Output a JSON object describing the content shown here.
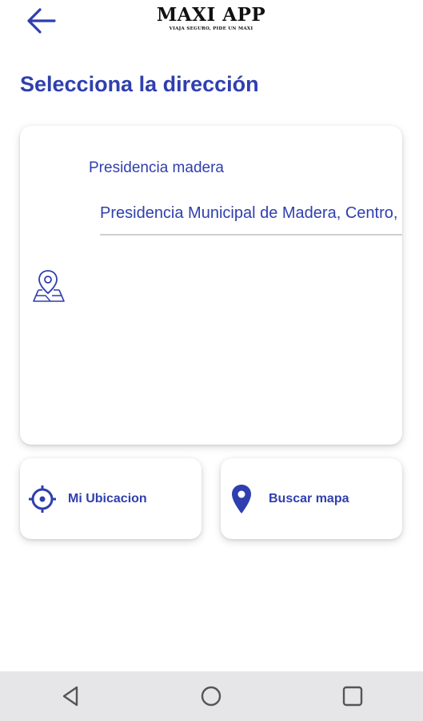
{
  "header": {
    "logo_title": "MAXI APP",
    "logo_subtitle": "VIAJA SEGURO, PIDE UN MAXI",
    "back_icon": "arrow-left-icon"
  },
  "page": {
    "title": "Selecciona la dirección"
  },
  "address": {
    "place_name": "Presidencia madera",
    "full_address": "Presidencia Municipal de Madera, Centro,",
    "icon": "map-pin-icon"
  },
  "actions": {
    "my_location_label": "Mi Ubicacion",
    "my_location_icon": "crosshair-icon",
    "search_map_label": "Buscar mapa",
    "search_map_icon": "location-pin-icon"
  },
  "nav": {
    "back_icon": "triangle-back-icon",
    "home_icon": "circle-home-icon",
    "recents_icon": "square-recents-icon"
  },
  "colors": {
    "accent": "#2f3fae",
    "nav_bg": "#e6e6e9"
  }
}
